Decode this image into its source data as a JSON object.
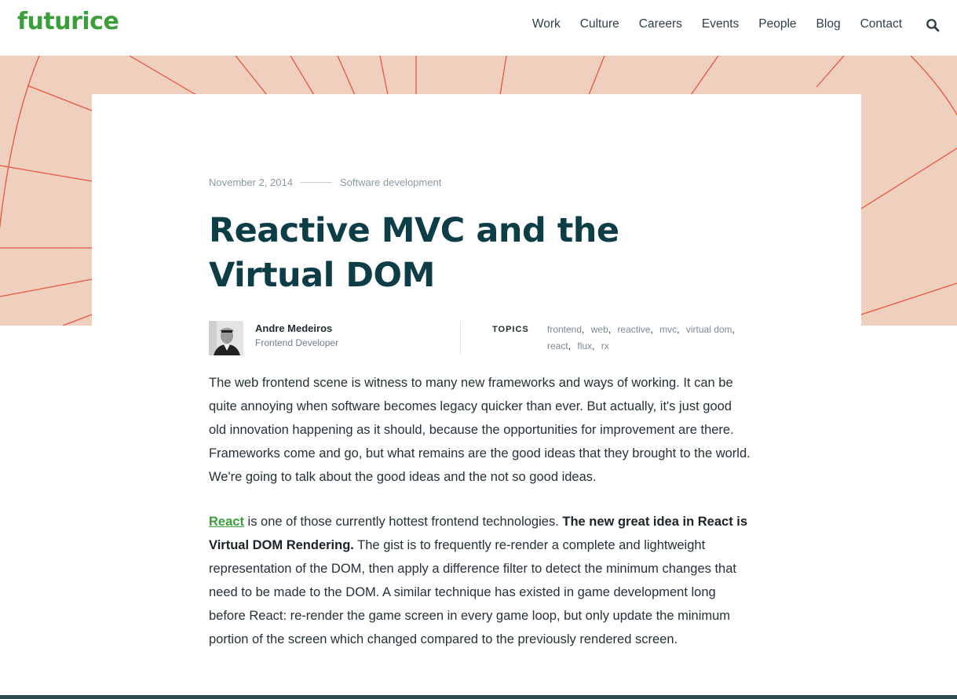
{
  "header": {
    "logo": "futurice",
    "nav": [
      "Work",
      "Culture",
      "Careers",
      "Events",
      "People",
      "Blog",
      "Contact"
    ],
    "search_icon": "search-icon"
  },
  "colors": {
    "brand": "#3a9e3a",
    "title": "#0d3d47",
    "hero_bg": "#efd0bf",
    "hero_lines": "#e8553f"
  },
  "article": {
    "date": "November 2, 2014",
    "category": "Software development",
    "title": "Reactive MVC and the Virtual DOM",
    "author": {
      "name": "Andre Medeiros",
      "role": "Frontend Developer"
    },
    "topics_label": "TOPICS",
    "topics": [
      "frontend",
      "web",
      "reactive",
      "mvc",
      "virtual dom",
      "react",
      "flux",
      "rx"
    ],
    "paragraph1": "The web frontend scene is witness to many new frameworks and ways of working. It can be quite annoying when software becomes legacy quicker than ever. But actually, it's just good old innovation happening as it should, because the opportunities for improvement are there. Frameworks come and go, but what remains are the good ideas that they brought to the world. We're going to talk about the good ideas and the not so good ideas.",
    "paragraph2": {
      "link": "React",
      "text1": " is one of those currently hottest frontend technologies. ",
      "bold": "The new great idea in React is Virtual DOM Rendering.",
      "text2": " The gist is to frequently re-render a complete and lightweight representation of the DOM, then apply a difference filter to detect the minimum changes that need to be made to the DOM. A similar technique has existed in game development long before React: re-render the game screen in every game loop, but only update the minimum portion of the screen which changed compared to the previously rendered screen."
    }
  }
}
